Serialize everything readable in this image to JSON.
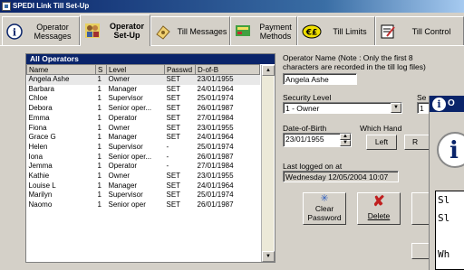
{
  "window": {
    "title": "SPEDI Link Till Set-Up"
  },
  "tabs": [
    {
      "label": "Operator Messages",
      "icon": "info-icon"
    },
    {
      "label": "Operator Set-Up",
      "icon": "operators-icon"
    },
    {
      "label": "Till Messages",
      "icon": "till-messages-icon"
    },
    {
      "label": "Payment Methods",
      "icon": "payment-icon"
    },
    {
      "label": "Till Limits",
      "icon": "till-limits-icon"
    },
    {
      "label": "Till Control",
      "icon": "till-control-icon"
    }
  ],
  "operators": {
    "group_title": "All Operators",
    "columns": [
      "Name",
      "S",
      "Level",
      "Passwd",
      "D-of-B"
    ],
    "rows": [
      [
        "Angela Ashe",
        "1",
        "Owner",
        "SET",
        "23/01/1955"
      ],
      [
        "Barbara",
        "1",
        "Manager",
        "SET",
        "24/01/1964"
      ],
      [
        "Chloe",
        "1",
        "Supervisor",
        "SET",
        "25/01/1974"
      ],
      [
        "Debora",
        "1",
        "Senior oper...",
        "SET",
        "26/01/1987"
      ],
      [
        "Emma",
        "1",
        "Operator",
        "SET",
        "27/01/1984"
      ],
      [
        "Fiona",
        "1",
        "Owner",
        "SET",
        "23/01/1955"
      ],
      [
        "Grace G",
        "1",
        "Manager",
        "SET",
        "24/01/1964"
      ],
      [
        "Helen",
        "1",
        "Supervisor",
        "-",
        "25/01/1974"
      ],
      [
        "Iona",
        "1",
        "Senior oper...",
        "-",
        "26/01/1987"
      ],
      [
        "Jemma",
        "1",
        "Operator",
        "-",
        "27/01/1984"
      ],
      [
        "Kathie",
        "1",
        "Owner",
        "SET",
        "23/01/1955"
      ],
      [
        "Louise L",
        "1",
        "Manager",
        "SET",
        "24/01/1964"
      ],
      [
        "Marilyn",
        "1",
        "Supervisor",
        "SET",
        "25/01/1974"
      ],
      [
        "Naomo",
        "1",
        "Senior oper",
        "SET",
        "26/01/1987"
      ]
    ]
  },
  "detail": {
    "name_label": "Operator Name  (Note : Only the first 8 characters are recorded in the till log files)",
    "name_value": "Angela Ashe",
    "security_label": "Security Level",
    "security_value": "1 - Owner",
    "se_label": "Se",
    "se_value": "1",
    "dob_label": "Date-of-Birth",
    "dob_value": "23/01/1955",
    "hand_label": "Which Hand",
    "left_label": "Left",
    "right_label": "R",
    "logged_label": "Last logged on at",
    "logged_value": "Wednesday 12/05/2004  10:07",
    "clear_label_1": "Clear",
    "clear_label_2": "Password",
    "delete_label": "Delete"
  },
  "dialog": {
    "title": "O",
    "lines": [
      "Sl",
      "Sl",
      "",
      "Wh"
    ]
  }
}
